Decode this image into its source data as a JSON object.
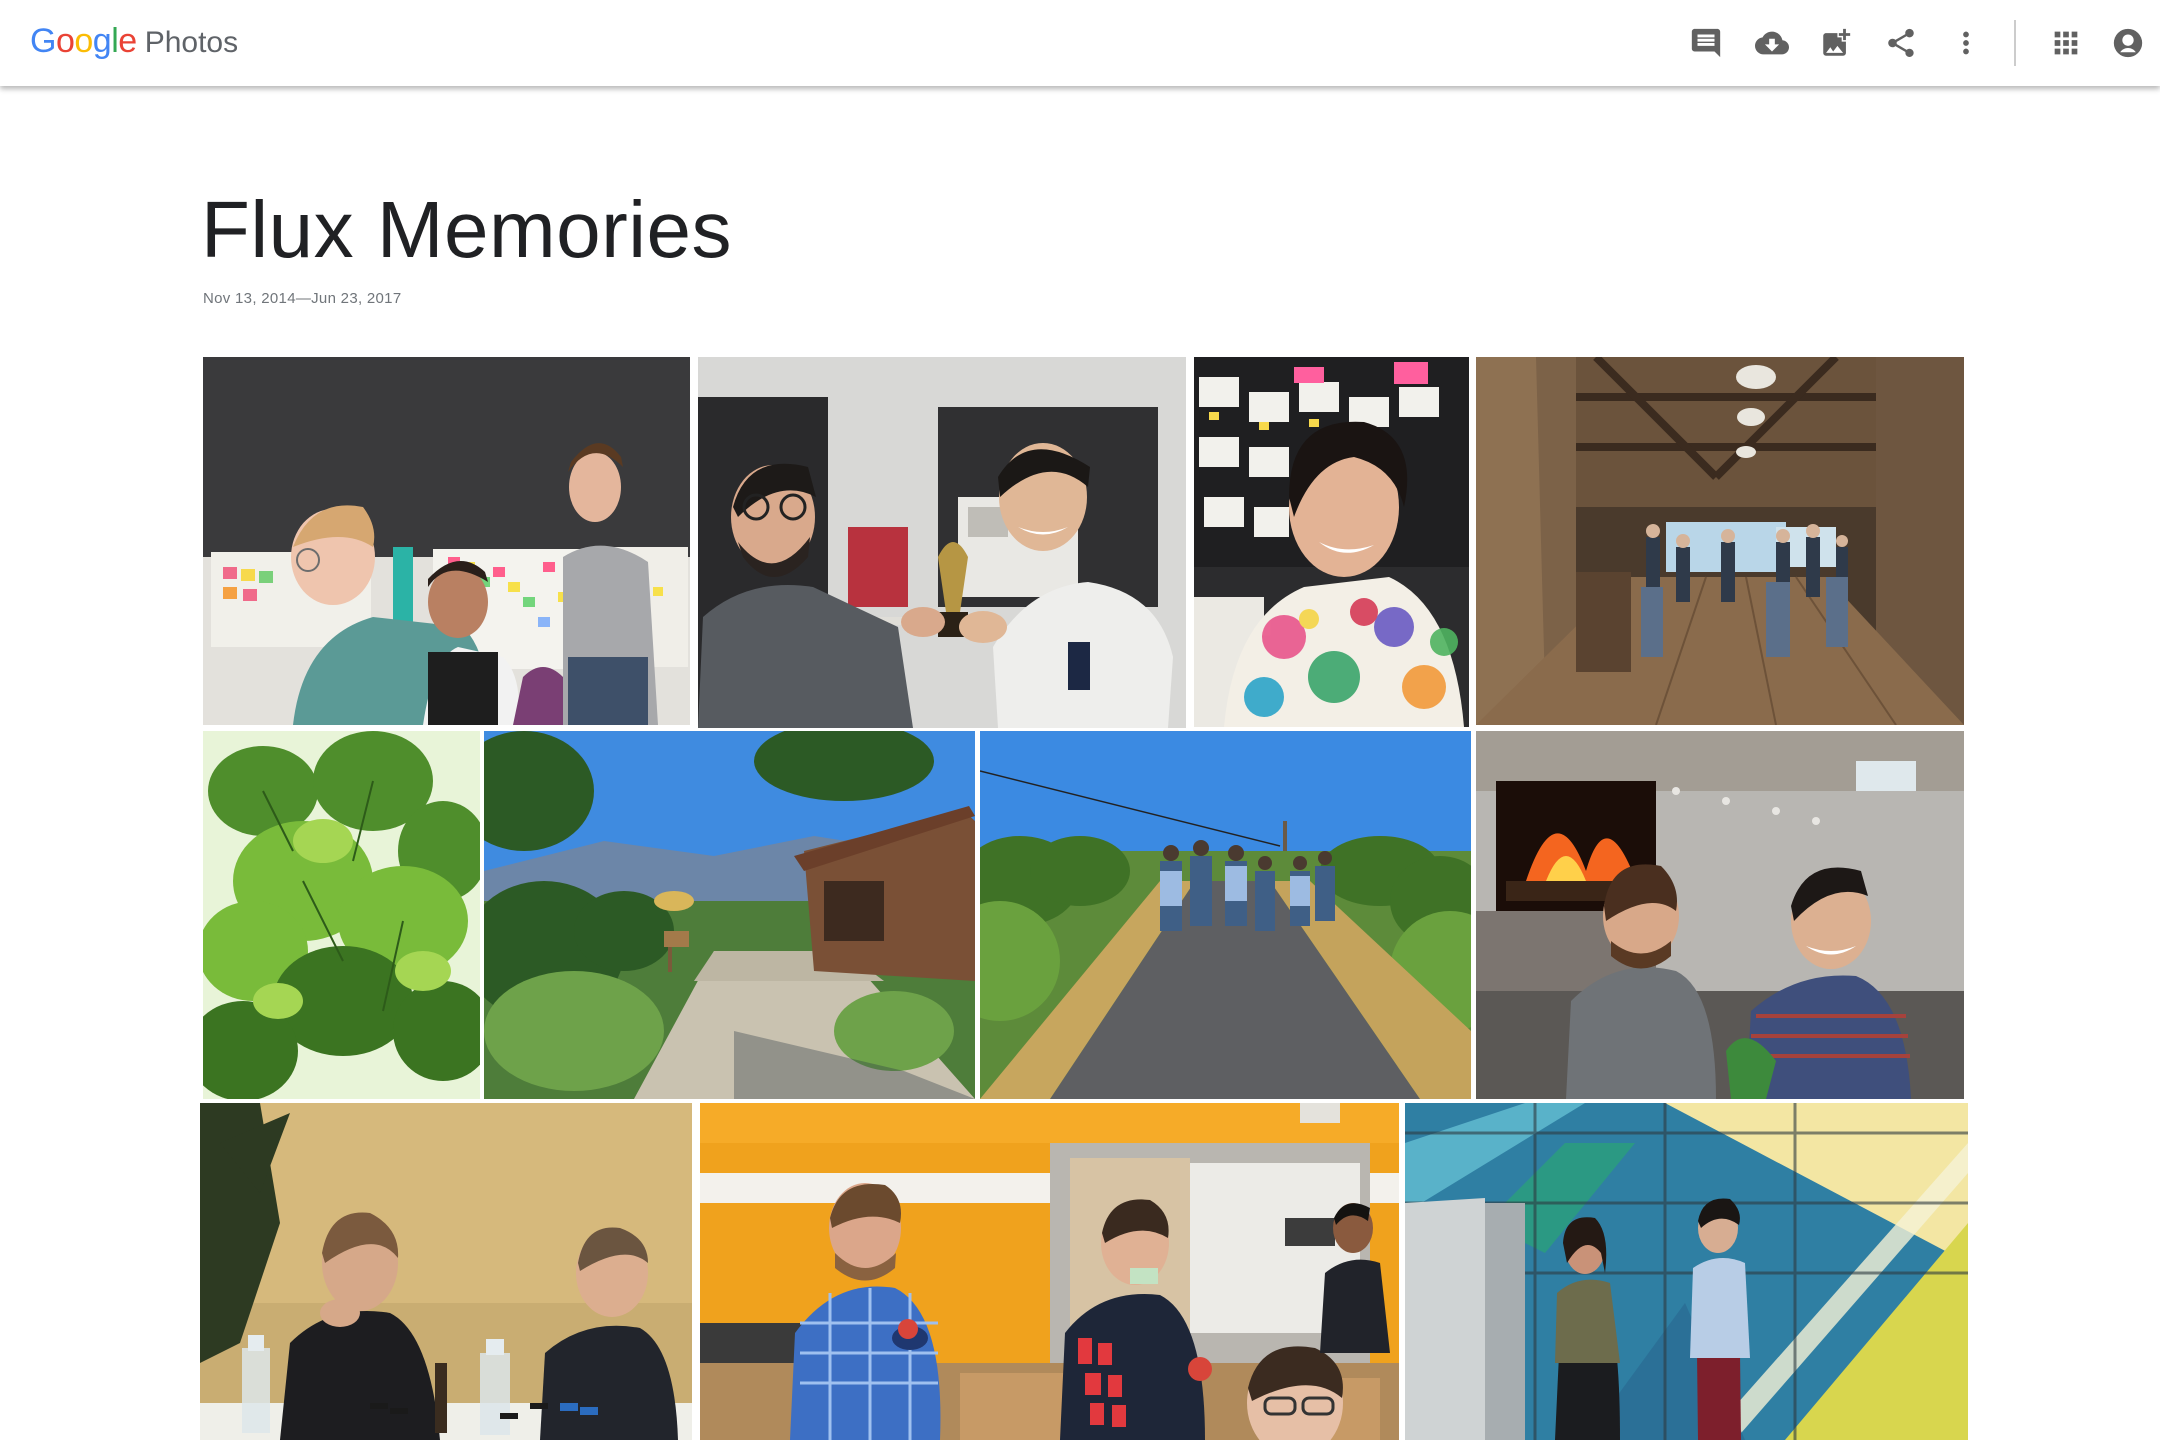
{
  "app": {
    "logo_letters": [
      {
        "char": "G",
        "color": "#4285F4"
      },
      {
        "char": "o",
        "color": "#EA4335"
      },
      {
        "char": "o",
        "color": "#FBBC05"
      },
      {
        "char": "g",
        "color": "#4285F4"
      },
      {
        "char": "l",
        "color": "#34A853"
      },
      {
        "char": "e",
        "color": "#EA4335"
      }
    ],
    "product": "Photos"
  },
  "toolbar": {
    "icons": [
      "comment-icon",
      "download-icon",
      "add-photo-icon",
      "share-icon",
      "more-vert-icon",
      "apps-icon",
      "account-icon"
    ]
  },
  "album": {
    "title": "Flux Memories",
    "date_range": "Nov 13, 2014—Jun 23, 2017"
  },
  "photos": [
    {
      "subject": "office-whiteboard-meeting"
    },
    {
      "subject": "trophy-handoff"
    },
    {
      "subject": "floral-shirt-portrait"
    },
    {
      "subject": "barn-venue-interior"
    },
    {
      "subject": "grape-vine-leaves"
    },
    {
      "subject": "hillside-garden-path"
    },
    {
      "subject": "vineyard-road-walk"
    },
    {
      "subject": "fireplace-lounge-duo"
    },
    {
      "subject": "poker-table"
    },
    {
      "subject": "food-bank-volunteers"
    },
    {
      "subject": "stage-presenters"
    }
  ]
}
